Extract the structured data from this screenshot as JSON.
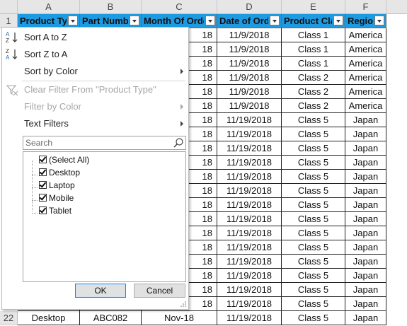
{
  "columns": [
    "A",
    "B",
    "C",
    "D",
    "E",
    "F"
  ],
  "headers": [
    "Product Type",
    "Part Number",
    "Month Of Order",
    "Date of Order",
    "Product Class",
    "Region"
  ],
  "row_numbers": [
    "1",
    "22"
  ],
  "rows": [
    {
      "month": "18",
      "date": "11/9/2018",
      "class": "Class 1",
      "region": "America"
    },
    {
      "month": "18",
      "date": "11/9/2018",
      "class": "Class 1",
      "region": "America"
    },
    {
      "month": "18",
      "date": "11/9/2018",
      "class": "Class 1",
      "region": "America"
    },
    {
      "month": "18",
      "date": "11/9/2018",
      "class": "Class 2",
      "region": "America"
    },
    {
      "month": "18",
      "date": "11/9/2018",
      "class": "Class 2",
      "region": "America"
    },
    {
      "month": "18",
      "date": "11/9/2018",
      "class": "Class 2",
      "region": "America"
    },
    {
      "month": "18",
      "date": "11/19/2018",
      "class": "Class 5",
      "region": "Japan"
    },
    {
      "month": "18",
      "date": "11/19/2018",
      "class": "Class 5",
      "region": "Japan"
    },
    {
      "month": "18",
      "date": "11/19/2018",
      "class": "Class 5",
      "region": "Japan"
    },
    {
      "month": "18",
      "date": "11/19/2018",
      "class": "Class 5",
      "region": "Japan"
    },
    {
      "month": "18",
      "date": "11/19/2018",
      "class": "Class 5",
      "region": "Japan"
    },
    {
      "month": "18",
      "date": "11/19/2018",
      "class": "Class 5",
      "region": "Japan"
    },
    {
      "month": "18",
      "date": "11/19/2018",
      "class": "Class 5",
      "region": "Japan"
    },
    {
      "month": "18",
      "date": "11/19/2018",
      "class": "Class 5",
      "region": "Japan"
    },
    {
      "month": "18",
      "date": "11/19/2018",
      "class": "Class 5",
      "region": "Japan"
    },
    {
      "month": "18",
      "date": "11/19/2018",
      "class": "Class 5",
      "region": "Japan"
    },
    {
      "month": "18",
      "date": "11/19/2018",
      "class": "Class 5",
      "region": "Japan"
    },
    {
      "month": "18",
      "date": "11/19/2018",
      "class": "Class 5",
      "region": "Japan"
    },
    {
      "month": "18",
      "date": "11/19/2018",
      "class": "Class 5",
      "region": "Japan"
    },
    {
      "month": "18",
      "date": "11/19/2018",
      "class": "Class 5",
      "region": "Japan"
    },
    {
      "product": "Desktop",
      "part": "ABC082",
      "month": "Nov-18",
      "date": "11/19/2018",
      "class": "Class 5",
      "region": "Japan"
    }
  ],
  "menu": {
    "sort_az": "Sort A to Z",
    "sort_za": "Sort Z to A",
    "sort_color": "Sort by Color",
    "clear_filter": "Clear Filter From \"Product Type\"",
    "filter_color": "Filter by Color",
    "text_filters": "Text Filters",
    "search_placeholder": "Search",
    "items": [
      "(Select All)",
      "Desktop",
      "Laptop",
      "Mobile",
      "Tablet"
    ],
    "ok": "OK",
    "cancel": "Cancel"
  },
  "colors": {
    "header_fill": "#1e9ae0",
    "button_focus": "#2f7fd0"
  }
}
